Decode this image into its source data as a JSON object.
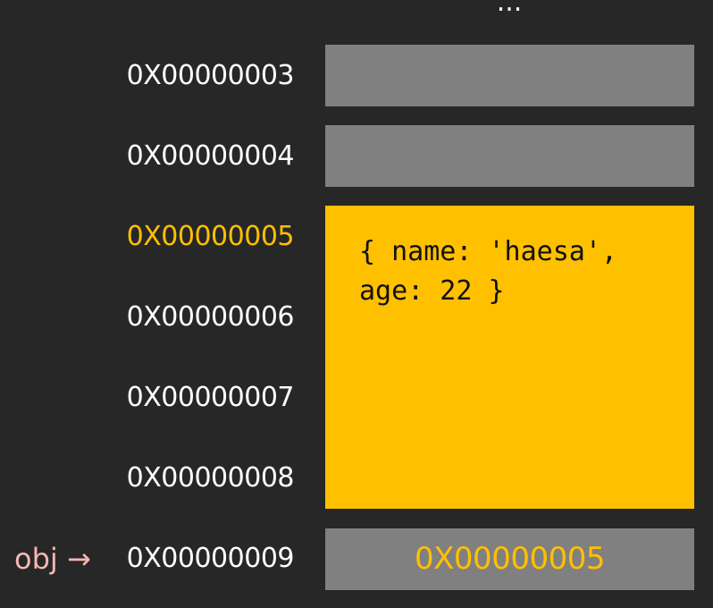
{
  "ellipsis": "...",
  "addresses": [
    {
      "label": "0X00000003",
      "highlight": false
    },
    {
      "label": "0X00000004",
      "highlight": false
    },
    {
      "label": "0X00000005",
      "highlight": true
    },
    {
      "label": "0X00000006",
      "highlight": false
    },
    {
      "label": "0X00000007",
      "highlight": false
    },
    {
      "label": "0X00000008",
      "highlight": false
    },
    {
      "label": "0X00000009",
      "highlight": false
    }
  ],
  "object_value": "{ name: 'haesa', age: 22 }",
  "reference_value": "0X00000005",
  "pointer_label": "obj →",
  "colors": {
    "background": "#272727",
    "empty_cell": "#808080",
    "highlight": "#ffc000",
    "pointer": "#f6b6b0"
  }
}
